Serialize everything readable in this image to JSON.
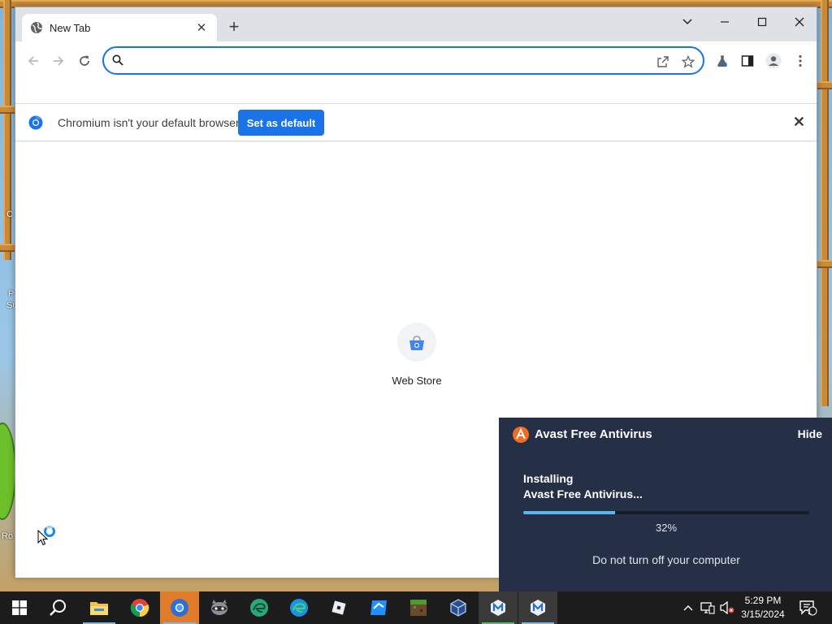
{
  "browser": {
    "tab": {
      "title": "New Tab",
      "close_glyph": "✕"
    },
    "new_tab_glyph": "+",
    "window_controls": [
      "chevron-down",
      "minimize",
      "maximize",
      "close"
    ],
    "omnibox": {
      "value": "",
      "placeholder": ""
    },
    "infobar": {
      "message": "Chromium isn't your default browser",
      "button": "Set as default",
      "close_glyph": "✕"
    },
    "shortcut": {
      "label": "Web Store"
    },
    "accent": "#1a73e8"
  },
  "avast": {
    "app_name": "Avast Free Antivirus",
    "hide": "Hide",
    "status_line1": "Installing",
    "status_line2": "Avast Free Antivirus...",
    "progress_percent": 32,
    "progress_text": "32%",
    "warning": "Do not turn off your computer",
    "bg_color": "#253047",
    "bar_color": "#5db4f2"
  },
  "desktop": {
    "fragments": [
      "C",
      "P",
      "Su",
      "Ro"
    ]
  },
  "taskbar": {
    "apps": [
      "start",
      "search",
      "file-explorer",
      "chrome",
      "chromium",
      "raccoon-app",
      "edge-beta",
      "edge",
      "roblox",
      "roblox-studio",
      "minecraft",
      "virtualbox",
      "malwarebytes-1",
      "malwarebytes-2"
    ],
    "clock": {
      "time": "5:29 PM",
      "date": "3/15/2024"
    },
    "notification_count": "1"
  }
}
